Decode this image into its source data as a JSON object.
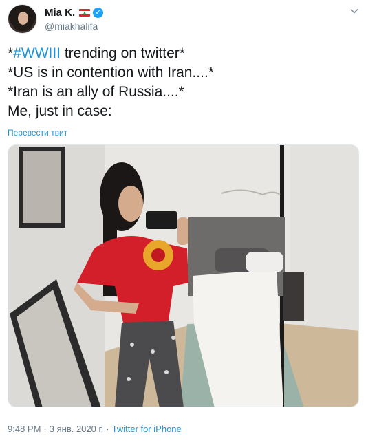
{
  "author": {
    "display_name": "Mia K.",
    "handle": "@miakhalifa",
    "flag_icon": "lebanon-flag-icon",
    "verified_icon": "verified-badge-icon"
  },
  "tweet": {
    "line1_prefix": "*",
    "hashtag": "#WWIII",
    "line1_suffix": " trending on twitter*",
    "line2": "*US is in contention with Iran....*",
    "line3": "*Iran is an ally of Russia....*",
    "line4": "Me, just in case:",
    "translate_label": "Перевести твит"
  },
  "meta": {
    "time": "9:48 PM",
    "separator": "·",
    "date": "3 янв. 2020 г.",
    "source": "Twitter for iPhone"
  },
  "colors": {
    "link": "#1b95e0",
    "text": "#14171a",
    "secondary": "#657786"
  }
}
